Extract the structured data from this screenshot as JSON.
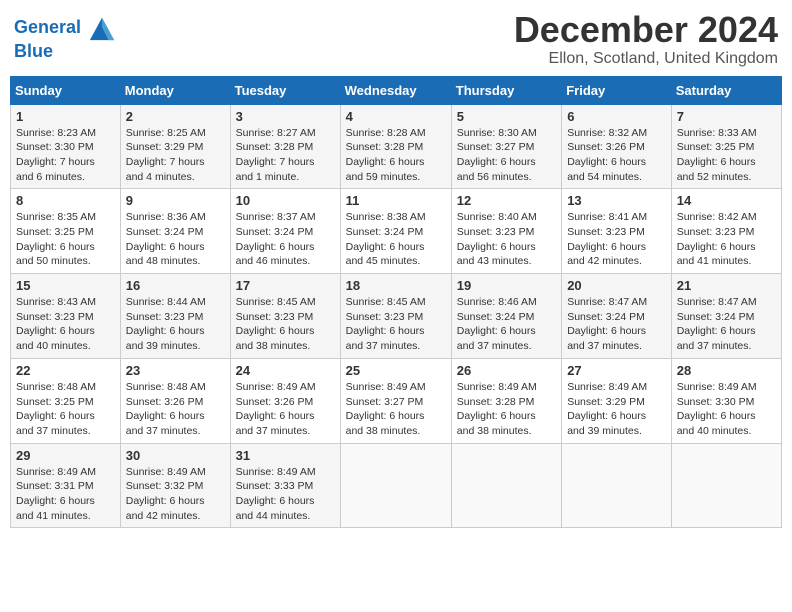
{
  "header": {
    "logo_line1": "General",
    "logo_line2": "Blue",
    "month": "December 2024",
    "location": "Ellon, Scotland, United Kingdom"
  },
  "weekdays": [
    "Sunday",
    "Monday",
    "Tuesday",
    "Wednesday",
    "Thursday",
    "Friday",
    "Saturday"
  ],
  "weeks": [
    [
      {
        "day": "1",
        "info": "Sunrise: 8:23 AM\nSunset: 3:30 PM\nDaylight: 7 hours\nand 6 minutes."
      },
      {
        "day": "2",
        "info": "Sunrise: 8:25 AM\nSunset: 3:29 PM\nDaylight: 7 hours\nand 4 minutes."
      },
      {
        "day": "3",
        "info": "Sunrise: 8:27 AM\nSunset: 3:28 PM\nDaylight: 7 hours\nand 1 minute."
      },
      {
        "day": "4",
        "info": "Sunrise: 8:28 AM\nSunset: 3:28 PM\nDaylight: 6 hours\nand 59 minutes."
      },
      {
        "day": "5",
        "info": "Sunrise: 8:30 AM\nSunset: 3:27 PM\nDaylight: 6 hours\nand 56 minutes."
      },
      {
        "day": "6",
        "info": "Sunrise: 8:32 AM\nSunset: 3:26 PM\nDaylight: 6 hours\nand 54 minutes."
      },
      {
        "day": "7",
        "info": "Sunrise: 8:33 AM\nSunset: 3:25 PM\nDaylight: 6 hours\nand 52 minutes."
      }
    ],
    [
      {
        "day": "8",
        "info": "Sunrise: 8:35 AM\nSunset: 3:25 PM\nDaylight: 6 hours\nand 50 minutes."
      },
      {
        "day": "9",
        "info": "Sunrise: 8:36 AM\nSunset: 3:24 PM\nDaylight: 6 hours\nand 48 minutes."
      },
      {
        "day": "10",
        "info": "Sunrise: 8:37 AM\nSunset: 3:24 PM\nDaylight: 6 hours\nand 46 minutes."
      },
      {
        "day": "11",
        "info": "Sunrise: 8:38 AM\nSunset: 3:24 PM\nDaylight: 6 hours\nand 45 minutes."
      },
      {
        "day": "12",
        "info": "Sunrise: 8:40 AM\nSunset: 3:23 PM\nDaylight: 6 hours\nand 43 minutes."
      },
      {
        "day": "13",
        "info": "Sunrise: 8:41 AM\nSunset: 3:23 PM\nDaylight: 6 hours\nand 42 minutes."
      },
      {
        "day": "14",
        "info": "Sunrise: 8:42 AM\nSunset: 3:23 PM\nDaylight: 6 hours\nand 41 minutes."
      }
    ],
    [
      {
        "day": "15",
        "info": "Sunrise: 8:43 AM\nSunset: 3:23 PM\nDaylight: 6 hours\nand 40 minutes."
      },
      {
        "day": "16",
        "info": "Sunrise: 8:44 AM\nSunset: 3:23 PM\nDaylight: 6 hours\nand 39 minutes."
      },
      {
        "day": "17",
        "info": "Sunrise: 8:45 AM\nSunset: 3:23 PM\nDaylight: 6 hours\nand 38 minutes."
      },
      {
        "day": "18",
        "info": "Sunrise: 8:45 AM\nSunset: 3:23 PM\nDaylight: 6 hours\nand 37 minutes."
      },
      {
        "day": "19",
        "info": "Sunrise: 8:46 AM\nSunset: 3:24 PM\nDaylight: 6 hours\nand 37 minutes."
      },
      {
        "day": "20",
        "info": "Sunrise: 8:47 AM\nSunset: 3:24 PM\nDaylight: 6 hours\nand 37 minutes."
      },
      {
        "day": "21",
        "info": "Sunrise: 8:47 AM\nSunset: 3:24 PM\nDaylight: 6 hours\nand 37 minutes."
      }
    ],
    [
      {
        "day": "22",
        "info": "Sunrise: 8:48 AM\nSunset: 3:25 PM\nDaylight: 6 hours\nand 37 minutes."
      },
      {
        "day": "23",
        "info": "Sunrise: 8:48 AM\nSunset: 3:26 PM\nDaylight: 6 hours\nand 37 minutes."
      },
      {
        "day": "24",
        "info": "Sunrise: 8:49 AM\nSunset: 3:26 PM\nDaylight: 6 hours\nand 37 minutes."
      },
      {
        "day": "25",
        "info": "Sunrise: 8:49 AM\nSunset: 3:27 PM\nDaylight: 6 hours\nand 38 minutes."
      },
      {
        "day": "26",
        "info": "Sunrise: 8:49 AM\nSunset: 3:28 PM\nDaylight: 6 hours\nand 38 minutes."
      },
      {
        "day": "27",
        "info": "Sunrise: 8:49 AM\nSunset: 3:29 PM\nDaylight: 6 hours\nand 39 minutes."
      },
      {
        "day": "28",
        "info": "Sunrise: 8:49 AM\nSunset: 3:30 PM\nDaylight: 6 hours\nand 40 minutes."
      }
    ],
    [
      {
        "day": "29",
        "info": "Sunrise: 8:49 AM\nSunset: 3:31 PM\nDaylight: 6 hours\nand 41 minutes."
      },
      {
        "day": "30",
        "info": "Sunrise: 8:49 AM\nSunset: 3:32 PM\nDaylight: 6 hours\nand 42 minutes."
      },
      {
        "day": "31",
        "info": "Sunrise: 8:49 AM\nSunset: 3:33 PM\nDaylight: 6 hours\nand 44 minutes."
      },
      {
        "day": "",
        "info": ""
      },
      {
        "day": "",
        "info": ""
      },
      {
        "day": "",
        "info": ""
      },
      {
        "day": "",
        "info": ""
      }
    ]
  ]
}
